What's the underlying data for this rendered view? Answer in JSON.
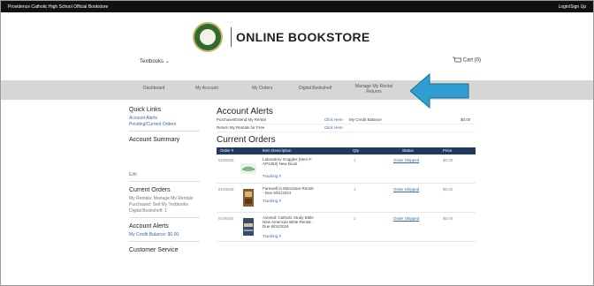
{
  "topbar": {
    "school": "Providence Catholic High School Official Bookstore",
    "login": "Login/Sign Up"
  },
  "logo": {
    "text": "ONLINE BOOKSTORE"
  },
  "header": {
    "textbooks": "Textbooks",
    "cart": "Cart (0)"
  },
  "nav": [
    "Dashboard",
    "My Account",
    "My Orders",
    "Digital Bookshelf",
    "Manage My Rental Returns"
  ],
  "sidebar": {
    "quick_links_title": "Quick Links",
    "quick_links": [
      "Account Alerts",
      "Pending/Current Orders"
    ],
    "account_summary_title": "Account Summary",
    "account_summary_value": "Edit",
    "current_orders_title": "Current Orders",
    "current_orders_text": "My Rentals: Manage My Rentals Purchased: Sell My Textbooks Digital Bookshelf: 1",
    "account_alerts_title": "Account Alerts",
    "account_alerts_text": "My Credit Balance: $0.00",
    "customer_service_title": "Customer Service"
  },
  "main": {
    "alerts_title": "Account Alerts",
    "alerts": [
      {
        "label": "Purchase/Extend My Rental",
        "action": "Click Here",
        "credit_label": "My Credit Balance",
        "credit_value": "$0.00"
      },
      {
        "label": "Return My Rentals for Free",
        "action": "Click Here"
      }
    ],
    "orders_title": "Current Orders",
    "columns": [
      "Order #",
      "Item Description",
      "Qty",
      "Status",
      "Price"
    ],
    "orders": [
      {
        "order": "8199265",
        "desc": "Laboratory Goggles (Item #: AP1363) New Book",
        "tracking": "Tracking #",
        "qty": "1",
        "status": "Order Shipped",
        "price": "$0.00"
      },
      {
        "order": "8199265",
        "desc": "Farewell to Manzanar Rental - Due 6/01/2024",
        "tracking": "Tracking #",
        "qty": "1",
        "status": "Order Shipped",
        "price": "$0.00"
      },
      {
        "order": "8199265",
        "desc": "Ascend: Catholic Study Bible New American Bible Rental - Due 6/01/2024",
        "tracking": "Tracking #",
        "qty": "1",
        "status": "Order Shipped",
        "price": "$0.00"
      }
    ]
  },
  "colors": {
    "accent": "#2f9fd3",
    "table_header": "#1f3a5e",
    "link": "#3a66a6"
  }
}
